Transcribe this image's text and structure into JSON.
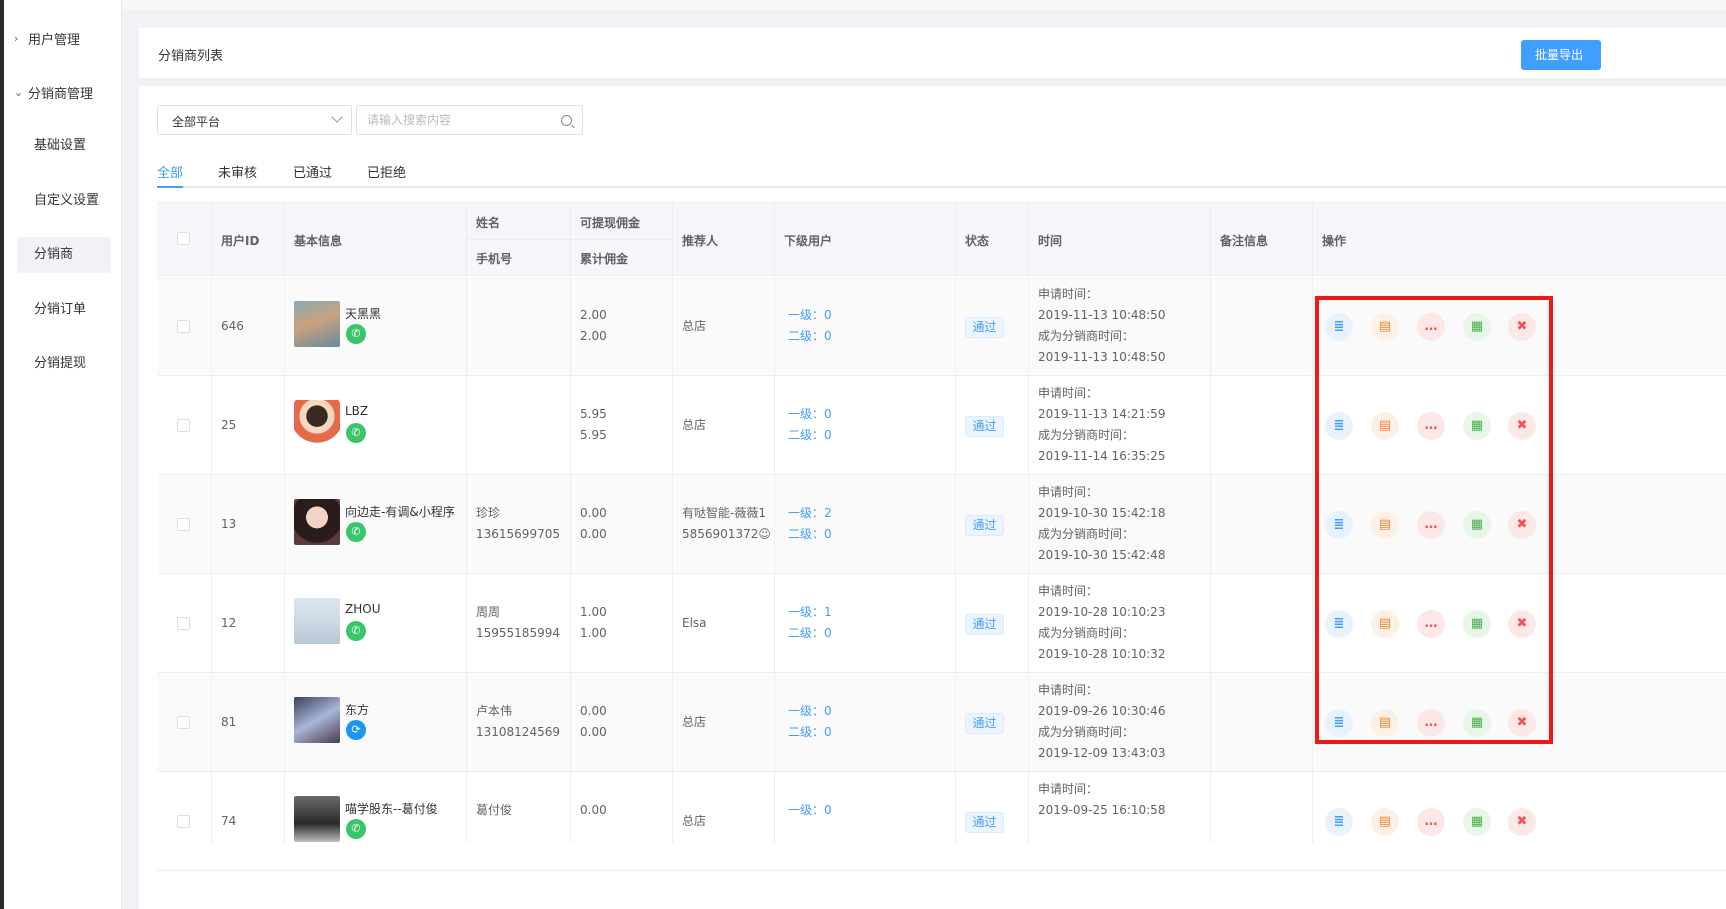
{
  "sidebar": {
    "groups": [
      {
        "label": "用户管理",
        "chevron": "›"
      },
      {
        "label": "分销商管理",
        "chevron": "⌄"
      }
    ],
    "items": [
      {
        "label": "基础设置"
      },
      {
        "label": "自定义设置"
      },
      {
        "label": "分销商"
      },
      {
        "label": "分销订单"
      },
      {
        "label": "分销提现"
      }
    ]
  },
  "header": {
    "title": "分销商列表",
    "export_label": "批量导出"
  },
  "filters": {
    "platform_value": "全部平台",
    "search_placeholder": "请输入搜索内容"
  },
  "tabs": [
    {
      "label": "全部",
      "active": true
    },
    {
      "label": "未审核"
    },
    {
      "label": "已通过"
    },
    {
      "label": "已拒绝"
    }
  ],
  "table": {
    "headers": {
      "user_id": "用户ID",
      "basic_info": "基本信息",
      "name": "姓名",
      "phone": "手机号",
      "withdrawable": "可提现佣金",
      "cumulative": "累计佣金",
      "referrer": "推荐人",
      "sub_users": "下级用户",
      "status": "状态",
      "time": "时间",
      "remark": "备注信息",
      "actions": "操作"
    },
    "rows": [
      {
        "id": "646",
        "nickname": "天黑黑",
        "platform": "wechat",
        "name": "",
        "phone": "",
        "withdrawable": "2.00",
        "cumulative": "2.00",
        "referrer_line1": "总店",
        "referrer_line2": "",
        "level1": "一级：0",
        "level2": "二级：0",
        "status": "通过",
        "apply_label": "申请时间：",
        "apply_time": "2019-11-13 10:48:50",
        "become_label": "成为分销商时间：",
        "become_time": "2019-11-13 10:48:50"
      },
      {
        "id": "25",
        "nickname": "LBZ",
        "platform": "wechat",
        "name": "",
        "phone": "",
        "withdrawable": "5.95",
        "cumulative": "5.95",
        "referrer_line1": "总店",
        "referrer_line2": "",
        "level1": "一级：0",
        "level2": "二级：0",
        "status": "通过",
        "apply_label": "申请时间：",
        "apply_time": "2019-11-13 14:21:59",
        "become_label": "成为分销商时间：",
        "become_time": "2019-11-14 16:35:25"
      },
      {
        "id": "13",
        "nickname": "向边走-有调&小程序",
        "platform": "wechat",
        "name": "珍珍",
        "phone": "13615699705",
        "withdrawable": "0.00",
        "cumulative": "0.00",
        "referrer_line1": "有哒智能-薇薇1",
        "referrer_line2": "5856901372☺",
        "level1": "一级：2",
        "level2": "二级：0",
        "status": "通过",
        "apply_label": "申请时间：",
        "apply_time": "2019-10-30 15:42:18",
        "become_label": "成为分销商时间：",
        "become_time": "2019-10-30 15:42:48"
      },
      {
        "id": "12",
        "nickname": "ZHOU",
        "platform": "wechat",
        "name": "周周",
        "phone": "15955185994",
        "withdrawable": "1.00",
        "cumulative": "1.00",
        "referrer_line1": "Elsa",
        "referrer_line2": "",
        "level1": "一级：1",
        "level2": "二级：0",
        "status": "通过",
        "apply_label": "申请时间：",
        "apply_time": "2019-10-28 10:10:23",
        "become_label": "成为分销商时间：",
        "become_time": "2019-10-28 10:10:32"
      },
      {
        "id": "81",
        "nickname": "东方",
        "platform": "miniprogram",
        "name": "卢本伟",
        "phone": "13108124569",
        "withdrawable": "0.00",
        "cumulative": "0.00",
        "referrer_line1": "总店",
        "referrer_line2": "",
        "level1": "一级：0",
        "level2": "二级：0",
        "status": "通过",
        "apply_label": "申请时间：",
        "apply_time": "2019-09-26 10:30:46",
        "become_label": "成为分销商时间：",
        "become_time": "2019-12-09 13:43:03"
      },
      {
        "id": "74",
        "nickname": "喵学股东--葛付俊",
        "platform": "wechat",
        "name": "葛付俊",
        "phone": "",
        "withdrawable": "0.00",
        "cumulative": "",
        "referrer_line1": "总店",
        "referrer_line2": "",
        "level1": "一级：0",
        "level2": "",
        "status": "通过",
        "apply_label": "申请时间：",
        "apply_time": "2019-09-25 16:10:58",
        "become_label": "",
        "become_time": ""
      }
    ],
    "action_icons": [
      "detail-icon",
      "qrcode-card-icon",
      "message-icon",
      "qrcode-icon",
      "delete-icon"
    ],
    "wechat_glyph": "✆",
    "mini_glyph": "⟳"
  },
  "colors": {
    "accent": "#409eff",
    "highlight": "#f01818",
    "wechat": "#3ac569"
  }
}
